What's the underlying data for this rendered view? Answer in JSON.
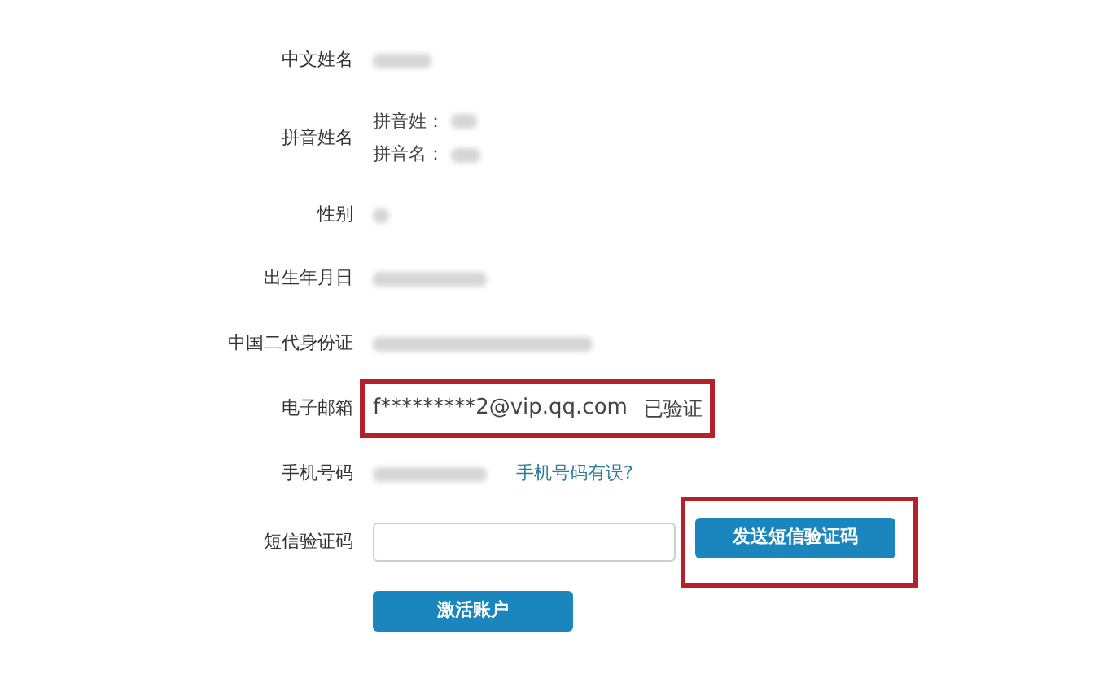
{
  "form": {
    "rows": [
      {
        "kind": "text",
        "label": "中文姓名"
      },
      {
        "kind": "pinyin",
        "label": "拼音姓名",
        "sublabels": [
          "拼音姓：",
          "拼音名："
        ]
      },
      {
        "kind": "text",
        "label": "性别"
      },
      {
        "kind": "text",
        "label": "出生年月日"
      },
      {
        "kind": "text",
        "label": "中国二代身份证"
      },
      {
        "kind": "email",
        "label": "电子邮箱",
        "value": "f*********2@vip.qq.com",
        "status": "已验证",
        "highlighted": true
      },
      {
        "kind": "phone",
        "label": "手机号码",
        "link": "手机号码有误?"
      },
      {
        "kind": "sms",
        "label": "短信验证码",
        "button": "发送短信验证码",
        "highlighted": true
      }
    ],
    "submit": "激活账户"
  }
}
